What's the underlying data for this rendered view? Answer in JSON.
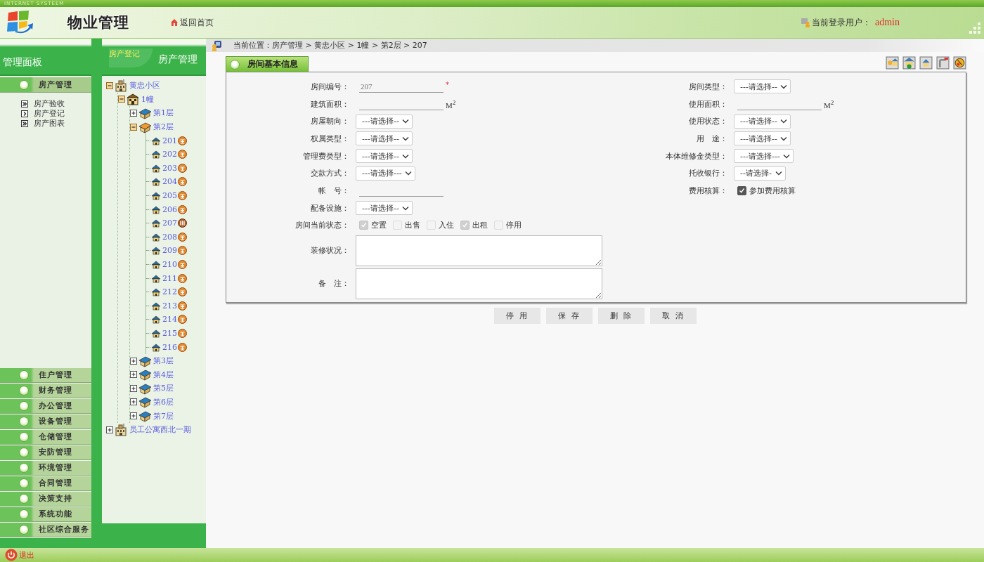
{
  "top_strip": {
    "text": "INTERNET SYSTEEM"
  },
  "header": {
    "title": "物业管理",
    "home_link": "返回首页",
    "user_label": "当前登录用户：",
    "user_name": "admin"
  },
  "sidebar": {
    "title": "管理面板",
    "sections": [
      {
        "label": "房产管理",
        "expanded": true,
        "items": [
          {
            "label": "房产验收",
            "selected": false
          },
          {
            "label": "房产登记",
            "selected": true
          },
          {
            "label": "房产图表",
            "selected": false
          }
        ]
      },
      {
        "label": "住户管理",
        "expanded": false
      },
      {
        "label": "财务管理",
        "expanded": false
      },
      {
        "label": "办公管理",
        "expanded": false
      },
      {
        "label": "设备管理",
        "expanded": false
      },
      {
        "label": "仓储管理",
        "expanded": false
      },
      {
        "label": "安防管理",
        "expanded": false
      },
      {
        "label": "环境管理",
        "expanded": false
      },
      {
        "label": "合同管理",
        "expanded": false
      },
      {
        "label": "决策支持",
        "expanded": false
      },
      {
        "label": "系统功能",
        "expanded": false
      },
      {
        "label": "社区综合服务",
        "expanded": false
      }
    ]
  },
  "tree_panel": {
    "tab": "房产登记",
    "title": "房产管理"
  },
  "tree": [
    {
      "label": "黄忠小区",
      "kind": "estate",
      "expanded": true,
      "children": [
        {
          "label": "1幢",
          "kind": "building",
          "expanded": true,
          "children": [
            {
              "label": "第1层",
              "kind": "floor",
              "expanded": false
            },
            {
              "label": "第2层",
              "kind": "floor",
              "expanded": true,
              "children": [
                {
                  "label": "201",
                  "kind": "room",
                  "rented": false
                },
                {
                  "label": "202",
                  "kind": "room",
                  "rented": false
                },
                {
                  "label": "203",
                  "kind": "room",
                  "rented": false
                },
                {
                  "label": "204",
                  "kind": "room",
                  "rented": false
                },
                {
                  "label": "205",
                  "kind": "room",
                  "rented": false
                },
                {
                  "label": "206",
                  "kind": "room",
                  "rented": false
                },
                {
                  "label": "207",
                  "kind": "room",
                  "rented": true
                },
                {
                  "label": "208",
                  "kind": "room",
                  "rented": false
                },
                {
                  "label": "209",
                  "kind": "room",
                  "rented": false
                },
                {
                  "label": "210",
                  "kind": "room",
                  "rented": false
                },
                {
                  "label": "211",
                  "kind": "room",
                  "rented": false
                },
                {
                  "label": "212",
                  "kind": "room",
                  "rented": false
                },
                {
                  "label": "213",
                  "kind": "room",
                  "rented": false
                },
                {
                  "label": "214",
                  "kind": "room",
                  "rented": false
                },
                {
                  "label": "215",
                  "kind": "room",
                  "rented": false
                },
                {
                  "label": "216",
                  "kind": "room",
                  "rented": false
                }
              ]
            },
            {
              "label": "第3层",
              "kind": "floor",
              "expanded": false
            },
            {
              "label": "第4层",
              "kind": "floor",
              "expanded": false
            },
            {
              "label": "第5层",
              "kind": "floor",
              "expanded": false
            },
            {
              "label": "第6层",
              "kind": "floor",
              "expanded": false
            },
            {
              "label": "第7层",
              "kind": "floor",
              "expanded": false
            }
          ]
        }
      ]
    },
    {
      "label": "员工公寓西北一期",
      "kind": "estate",
      "expanded": false
    }
  ],
  "breadcrumb": "当前位置：房产管理 > 黄忠小区 > 1幢 > 第2层 > 207",
  "panel": {
    "title": "房间基本信息",
    "left_fields": [
      {
        "label": "房间编号：",
        "kind": "text",
        "value": "207",
        "readonly": true,
        "mark": "*"
      },
      {
        "label": "建筑面积：",
        "kind": "text",
        "unit": "M$^{2}$"
      },
      {
        "label": "房屋朝向：",
        "kind": "select",
        "value": "---请选择--"
      },
      {
        "label": "权属类型：",
        "kind": "select",
        "value": "---请选择--"
      },
      {
        "label": "管理费类型：",
        "kind": "select",
        "value": "---请选择--"
      },
      {
        "label": "交款方式：",
        "kind": "select",
        "value": "---请选择---"
      },
      {
        "label": "帐　号：",
        "kind": "text"
      },
      {
        "label": "配备设施：",
        "kind": "select",
        "value": "---请选择--"
      },
      {
        "label": "房间当前状态：",
        "kind": "checks",
        "options": [
          {
            "label": "空置",
            "checked": true,
            "disabled": true
          },
          {
            "label": "出售",
            "checked": false,
            "disabled": true
          },
          {
            "label": "入住",
            "checked": false,
            "disabled": true
          },
          {
            "label": "出租",
            "checked": true,
            "disabled": true
          },
          {
            "label": "停用",
            "checked": false,
            "disabled": true
          }
        ]
      },
      {
        "label": "装修状况：",
        "kind": "textarea"
      },
      {
        "label": "备　注：",
        "kind": "textarea"
      }
    ],
    "right_fields": [
      {
        "label": "房间类型：",
        "kind": "select",
        "value": "---请选择--"
      },
      {
        "label": "使用面积：",
        "kind": "text",
        "unit": "M$^{2}$"
      },
      {
        "label": "使用状态：",
        "kind": "select",
        "value": "---请选择--"
      },
      {
        "label": "用　途：",
        "kind": "select",
        "value": "---请选择--"
      },
      {
        "label": "本体维修金类型：",
        "kind": "select",
        "value": "---请选择---"
      },
      {
        "label": "托收银行：",
        "kind": "select",
        "value": "--请选择-"
      },
      {
        "label": "费用核算：",
        "kind": "checks",
        "options": [
          {
            "label": "参加费用核算",
            "checked": true,
            "disabled": false
          }
        ]
      }
    ]
  },
  "buttons": [
    "停 用",
    "保 存",
    "删 除",
    "取 消"
  ],
  "footer": {
    "logout": "退出"
  }
}
